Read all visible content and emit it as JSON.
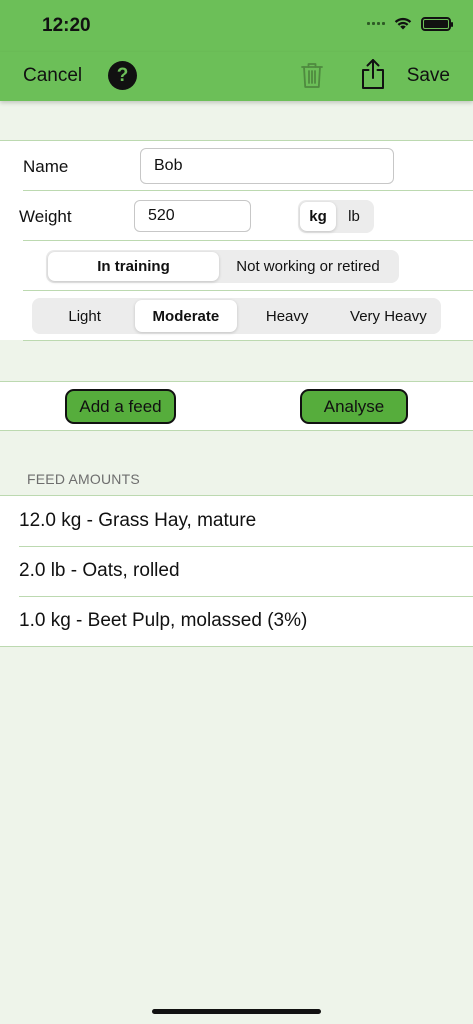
{
  "status_bar": {
    "time": "12:20"
  },
  "nav": {
    "cancel_label": "Cancel",
    "help_label": "?",
    "save_label": "Save"
  },
  "form": {
    "name_label": "Name",
    "name_value": "Bob",
    "weight_label": "Weight",
    "weight_value": "520",
    "units": [
      "kg",
      "lb"
    ],
    "selected_unit": "kg",
    "work_status": [
      "In training",
      "Not working or retired"
    ],
    "selected_work_status": "In training",
    "intensity": [
      "Light",
      "Moderate",
      "Heavy",
      "Very Heavy"
    ],
    "selected_intensity": "Moderate"
  },
  "actions": {
    "add_feed_label": "Add a feed",
    "analyse_label": "Analyse"
  },
  "feeds": {
    "header": "FEED AMOUNTS",
    "items": [
      "12.0 kg - Grass Hay, mature",
      "2.0 lb - Oats, rolled",
      "1.0 kg - Beet Pulp, molassed (3%)"
    ]
  },
  "icons": {
    "help": "question-mark-circle-icon",
    "trash": "trash-icon",
    "share": "share-icon",
    "wifi": "wifi-icon",
    "battery": "battery-icon",
    "signal": "cellular-signal-icon"
  },
  "colors": {
    "accent_green": "#6cbf58",
    "button_green": "#56ad3c",
    "background": "#eef4ea",
    "separator": "#bcd9b0"
  }
}
